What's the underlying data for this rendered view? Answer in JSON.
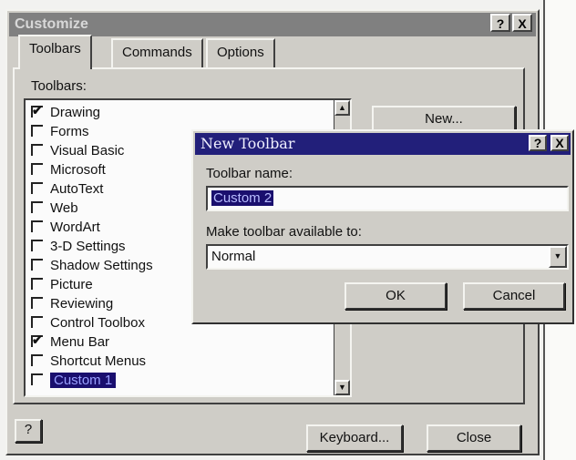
{
  "customize": {
    "title": "Customize",
    "help_btn": "?",
    "close_btn": "X",
    "tabs": [
      "Toolbars",
      "Commands",
      "Options"
    ],
    "list_label": "Toolbars:",
    "toolbars": [
      {
        "label": "Drawing",
        "checked": true
      },
      {
        "label": "Forms",
        "checked": false
      },
      {
        "label": "Visual Basic",
        "checked": false
      },
      {
        "label": "Microsoft",
        "checked": false
      },
      {
        "label": "AutoText",
        "checked": false
      },
      {
        "label": "Web",
        "checked": false
      },
      {
        "label": "WordArt",
        "checked": false
      },
      {
        "label": "3-D Settings",
        "checked": false
      },
      {
        "label": "Shadow Settings",
        "checked": false
      },
      {
        "label": "Picture",
        "checked": false
      },
      {
        "label": "Reviewing",
        "checked": false
      },
      {
        "label": "Control Toolbox",
        "checked": false
      },
      {
        "label": "Menu Bar",
        "checked": true
      },
      {
        "label": "Shortcut Menus",
        "checked": false
      },
      {
        "label": "Custom 1",
        "checked": false,
        "selected": true
      }
    ],
    "new_button": "New...",
    "keyboard_button": "Keyboard...",
    "close_button": "Close"
  },
  "new_toolbar": {
    "title": "New Toolbar",
    "help_btn": "?",
    "close_btn": "X",
    "name_label": "Toolbar name:",
    "name_value": "Custom 2",
    "available_label": "Make toolbar available to:",
    "available_value": "Normal",
    "ok": "OK",
    "cancel": "Cancel"
  }
}
